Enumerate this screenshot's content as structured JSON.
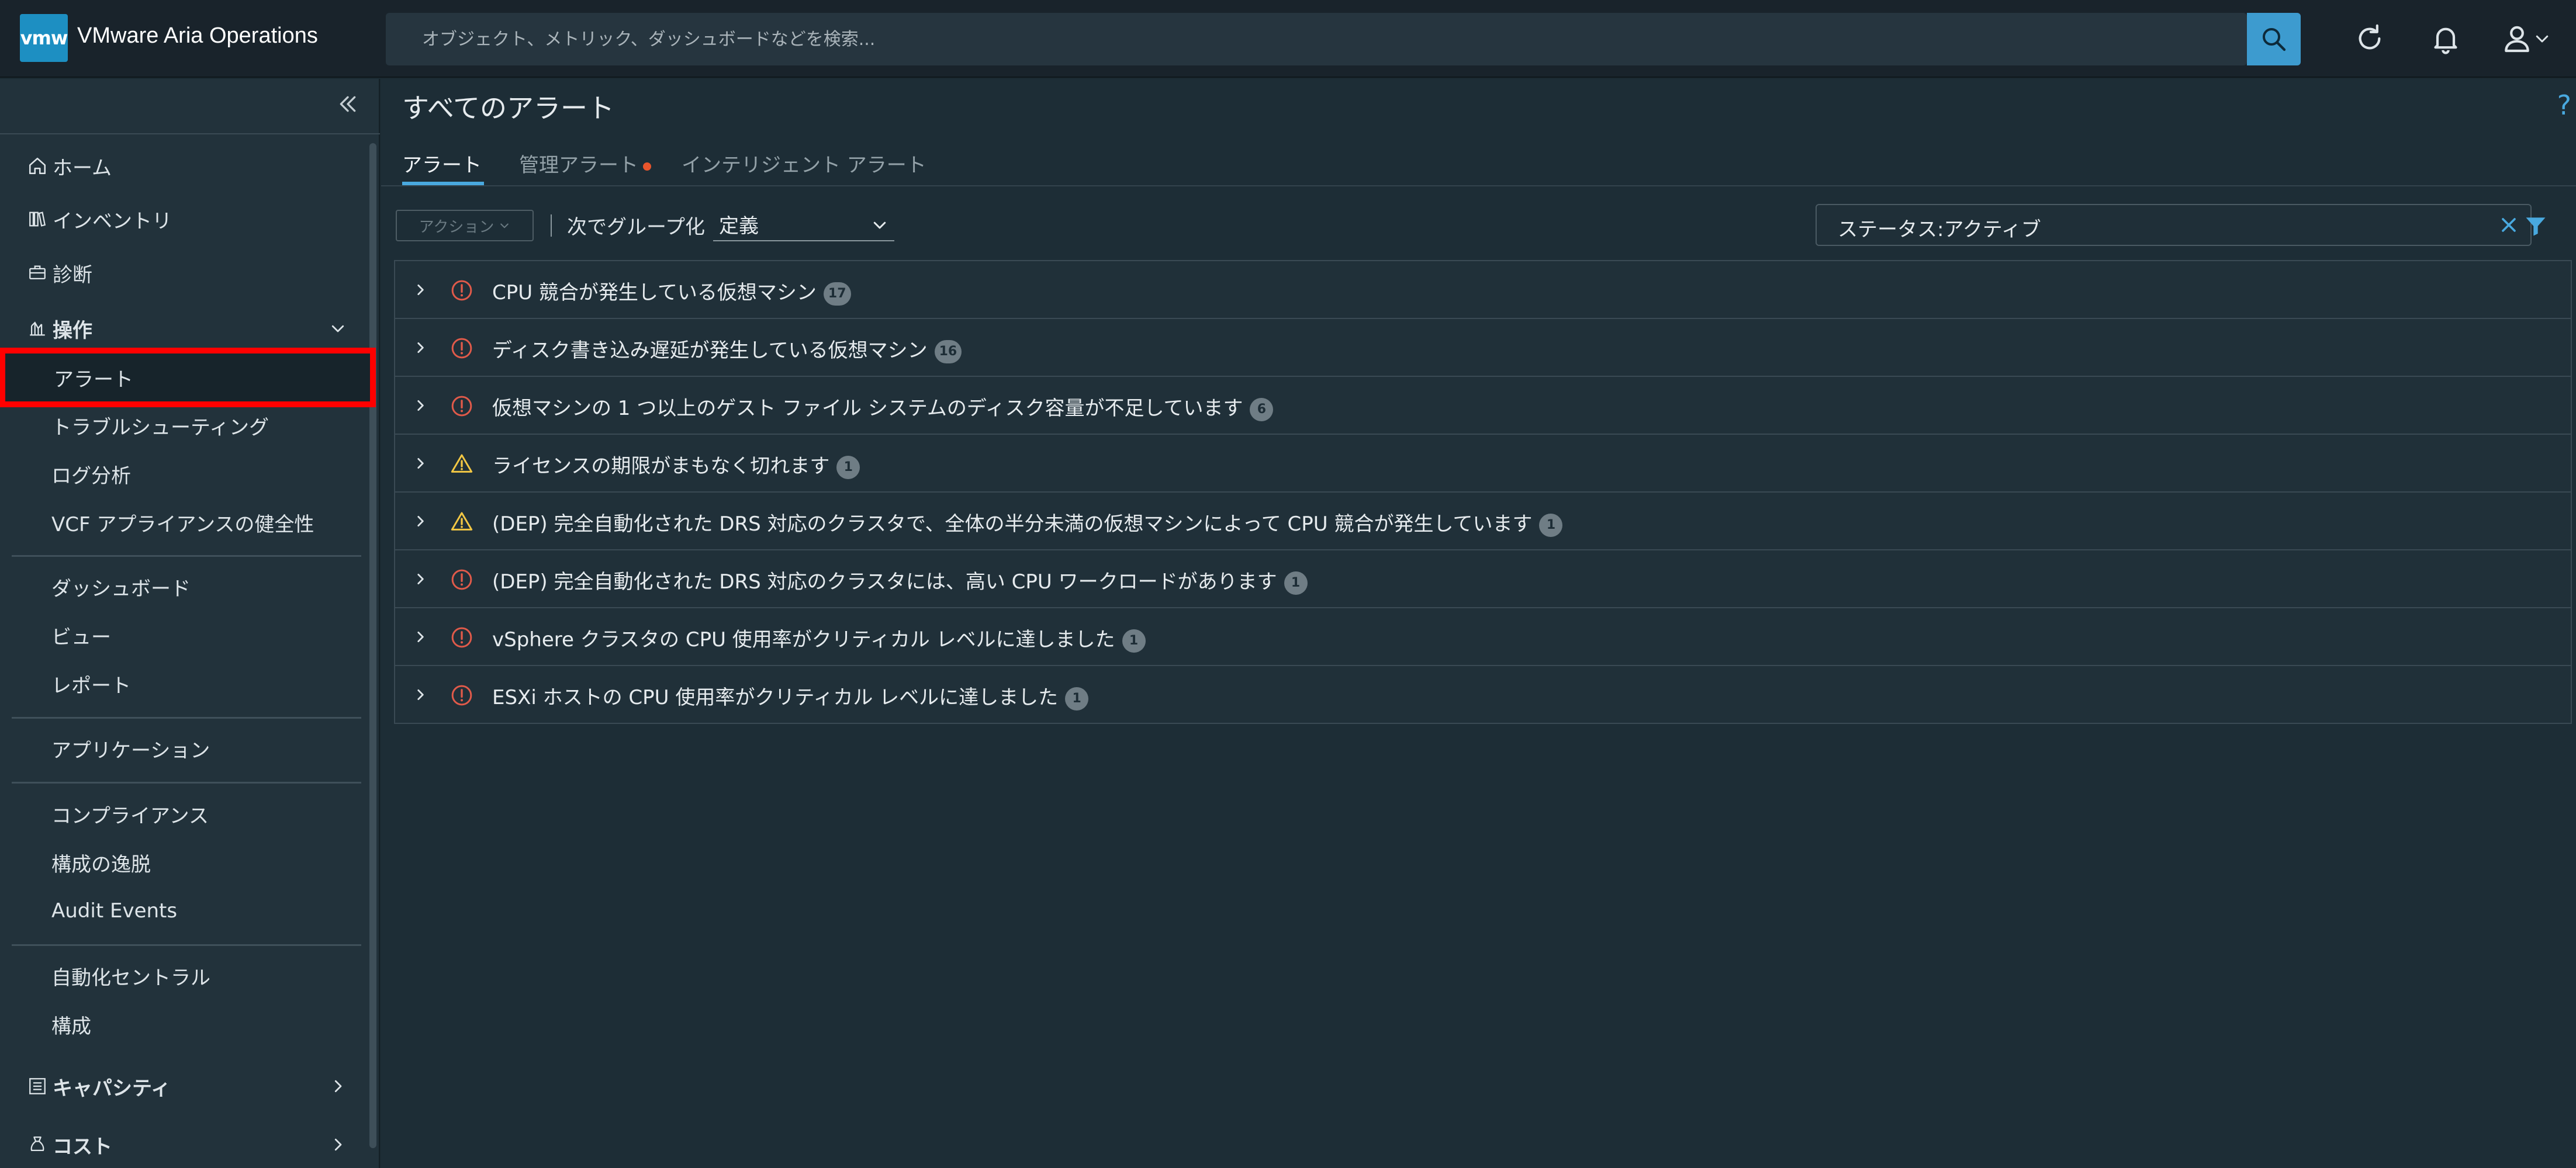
{
  "header": {
    "logo_text": "vmw",
    "app_title": "VMware Aria Operations",
    "search_placeholder": "オブジェクト、メトリック、ダッシュボードなどを検索..."
  },
  "sidebar": {
    "items": [
      {
        "label": "ホーム"
      },
      {
        "label": "インベントリ"
      },
      {
        "label": "診断"
      },
      {
        "label": "操作"
      },
      {
        "label": "アラート"
      },
      {
        "label": "トラブルシューティング"
      },
      {
        "label": "ログ分析"
      },
      {
        "label": "VCF アプライアンスの健全性"
      },
      {
        "label": "ダッシュボード"
      },
      {
        "label": "ビュー"
      },
      {
        "label": "レポート"
      },
      {
        "label": "アプリケーション"
      },
      {
        "label": "コンプライアンス"
      },
      {
        "label": "構成の逸脱"
      },
      {
        "label": "Audit Events"
      },
      {
        "label": "自動化セントラル"
      },
      {
        "label": "構成"
      },
      {
        "label": "キャパシティ"
      },
      {
        "label": "コスト"
      }
    ]
  },
  "main": {
    "title": "すべてのアラート",
    "help": "?",
    "tabs": [
      {
        "label": "アラート"
      },
      {
        "label": "管理アラート"
      },
      {
        "label": "インテリジェント アラート"
      }
    ],
    "toolbar": {
      "action_label": "アクション",
      "group_by_label": "次でグループ化",
      "group_by_value": "定義"
    },
    "filter_text": "ステータス:アクティブ",
    "alerts": [
      {
        "name": "CPU 競合が発生している仮想マシン",
        "count": "17",
        "severity": "critical"
      },
      {
        "name": "ディスク書き込み遅延が発生している仮想マシン",
        "count": "16",
        "severity": "critical"
      },
      {
        "name": "仮想マシンの 1 つ以上のゲスト ファイル システムのディスク容量が不足しています",
        "count": "6",
        "severity": "critical"
      },
      {
        "name": "ライセンスの期限がまもなく切れます",
        "count": "1",
        "severity": "warning"
      },
      {
        "name": "(DEP) 完全自動化された DRS 対応のクラスタで、全体の半分未満の仮想マシンによって CPU 競合が発生しています",
        "count": "1",
        "severity": "warning"
      },
      {
        "name": "(DEP) 完全自動化された DRS 対応のクラスタには、高い CPU ワークロードがあります",
        "count": "1",
        "severity": "critical"
      },
      {
        "name": "vSphere クラスタの CPU 使用率がクリティカル レベルに達しました",
        "count": "1",
        "severity": "critical"
      },
      {
        "name": "ESXi ホストの CPU 使用率がクリティカル レベルに達しました",
        "count": "1",
        "severity": "critical"
      }
    ]
  },
  "colors": {
    "accent": "#49a9df",
    "critical": "#e05a4a",
    "warning": "#f2c744",
    "highlight": "#ff0000"
  }
}
